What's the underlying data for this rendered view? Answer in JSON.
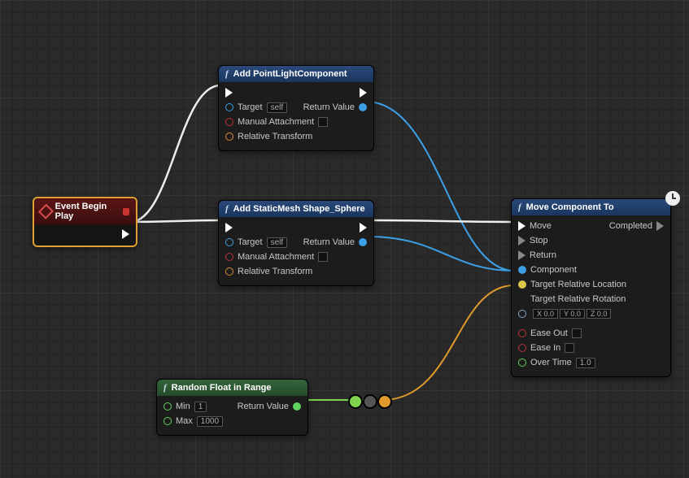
{
  "nodes": {
    "event": {
      "title": "Event Begin Play"
    },
    "addPoint": {
      "title": "Add PointLightComponent",
      "target": "Target",
      "self": "self",
      "manual": "Manual Attachment",
      "relative": "Relative Transform",
      "retval": "Return Value"
    },
    "addMesh": {
      "title": "Add StaticMesh Shape_Sphere",
      "target": "Target",
      "self": "self",
      "manual": "Manual Attachment",
      "relative": "Relative Transform",
      "retval": "Return Value"
    },
    "move": {
      "title": "Move Component To",
      "move": "Move",
      "completed": "Completed",
      "stop": "Stop",
      "return": "Return",
      "component": "Component",
      "trl": "Target Relative Location",
      "trr": "Target Relative Rotation",
      "rot": {
        "x": "X 0.0",
        "y": "Y 0.0",
        "z": "Z 0.0"
      },
      "easeout": "Ease Out",
      "easein": "Ease In",
      "overtime": "Over Time",
      "overtime_val": "1.0"
    },
    "rand": {
      "title": "Random Float in Range",
      "min": "Min",
      "min_val": "1",
      "max": "Max",
      "max_val": "1000",
      "retval": "Return Value"
    }
  }
}
